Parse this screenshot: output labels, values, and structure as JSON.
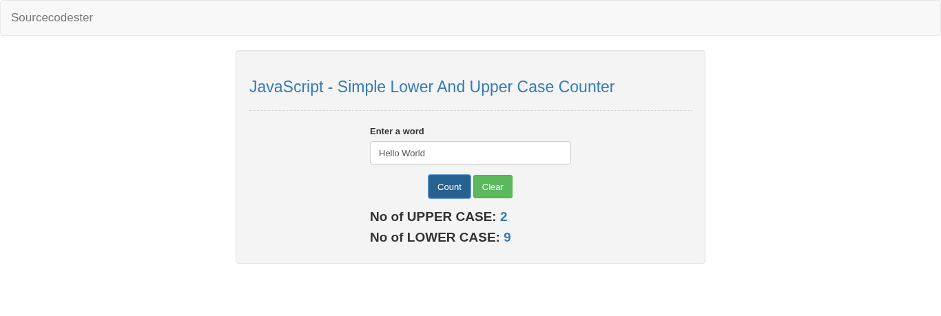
{
  "navbar": {
    "brand": "Sourcecodester"
  },
  "card": {
    "title": "JavaScript - Simple Lower And Upper Case Counter",
    "field": {
      "label": "Enter a word",
      "value": "Hello World"
    },
    "buttons": [
      {
        "label": "Count",
        "kind": "primary",
        "active": true
      },
      {
        "label": "Clear",
        "kind": "success",
        "active": false
      }
    ],
    "results": [
      {
        "label": "No of UPPER CASE:",
        "value": "2"
      },
      {
        "label": "No of LOWER CASE:",
        "value": "9"
      }
    ]
  }
}
